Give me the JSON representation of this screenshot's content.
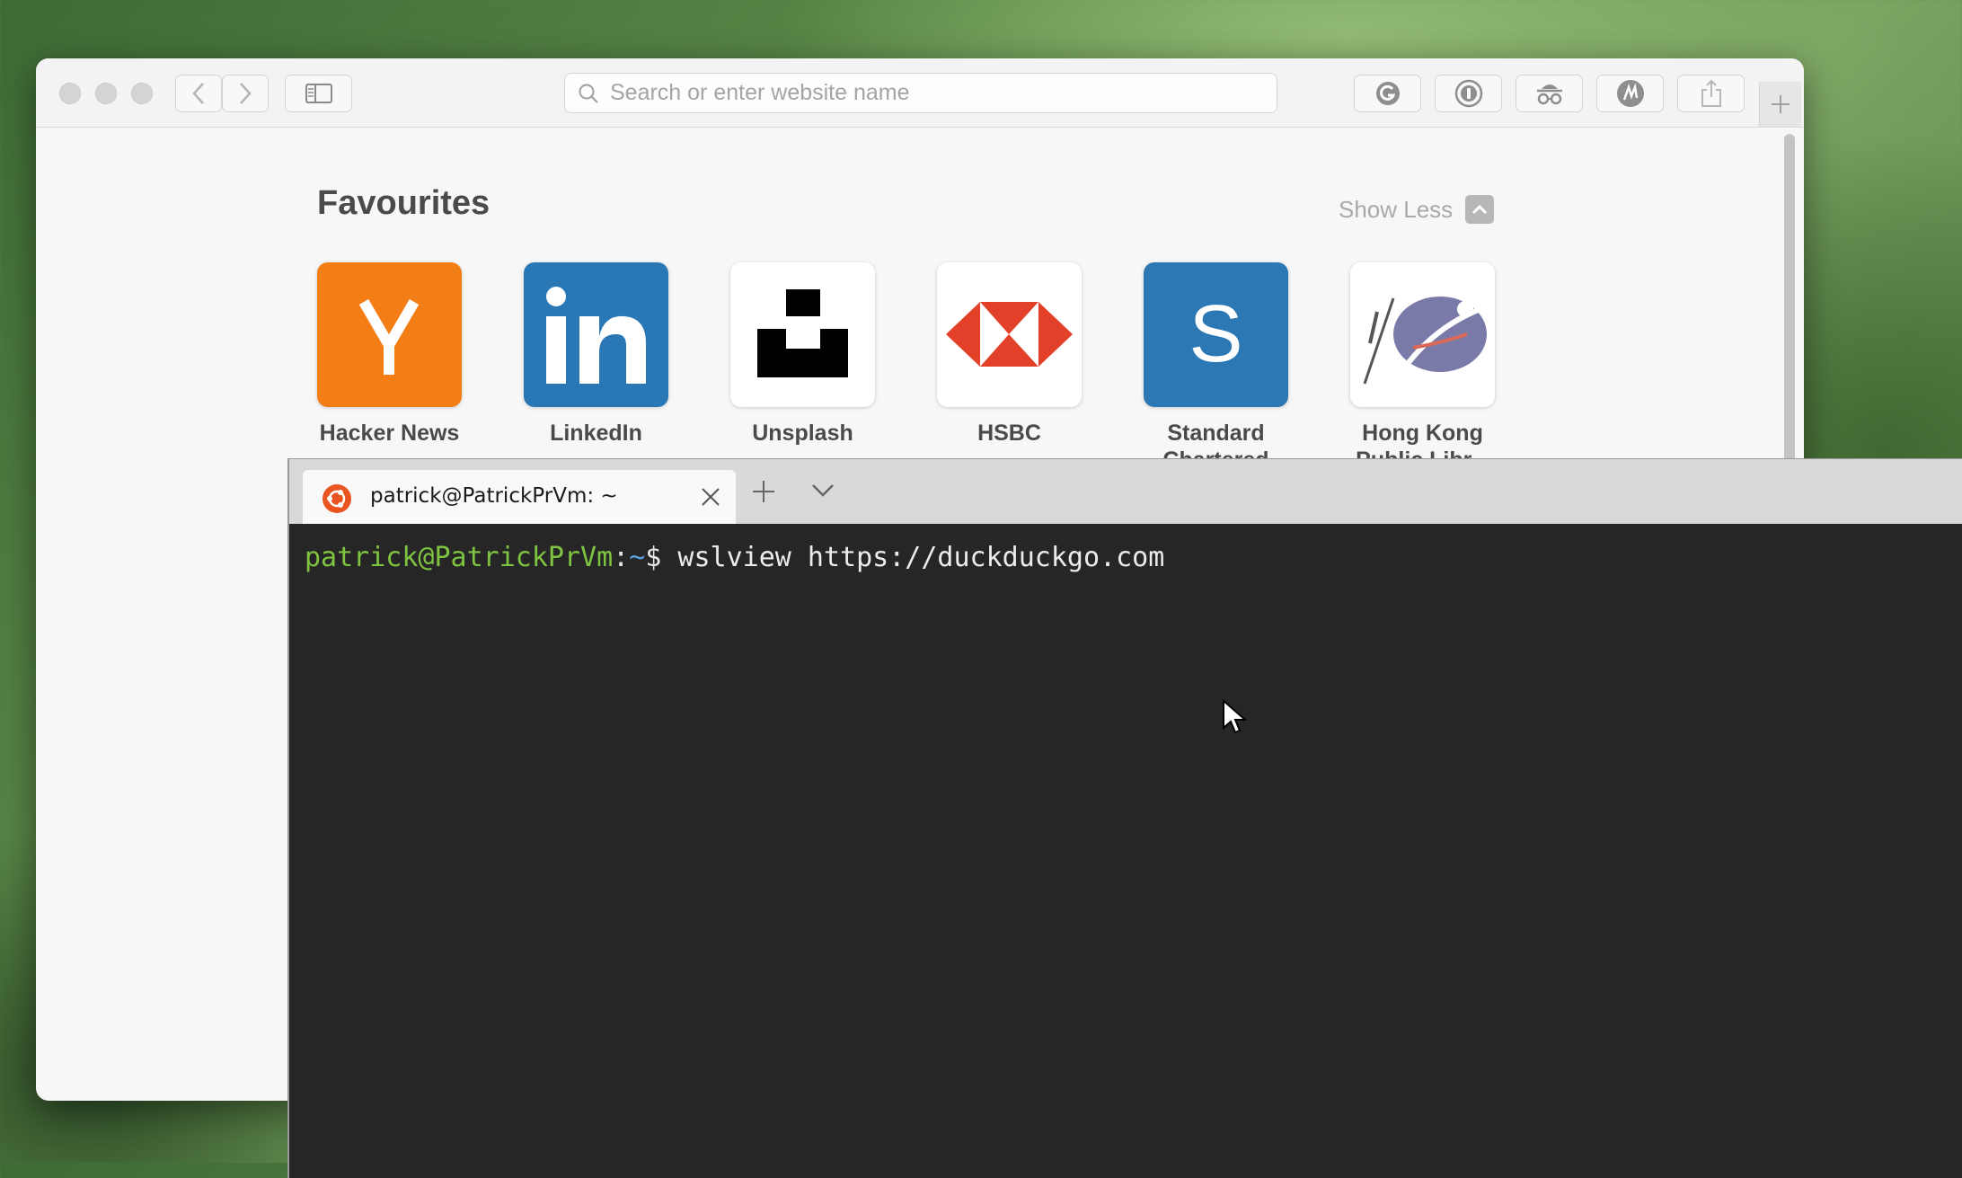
{
  "browser": {
    "search": {
      "placeholder": "Search or enter website name"
    },
    "favourites": {
      "title": "Favourites",
      "toggle_label": "Show Less",
      "items": [
        {
          "label": "Hacker News",
          "icon": "y-combinator-icon",
          "color": "#f47e16"
        },
        {
          "label": "LinkedIn",
          "icon": "linkedin-icon",
          "color": "#2977b5"
        },
        {
          "label": "Unsplash",
          "icon": "unsplash-icon",
          "color": "#000000"
        },
        {
          "label": "HSBC",
          "icon": "hsbc-icon",
          "color": "#db0011"
        },
        {
          "label": "Standard Chartered",
          "icon": "standard-chartered-icon",
          "color": "#2b78b4",
          "glyph": "S"
        },
        {
          "label": "Hong Kong Public Libr...",
          "icon": "hkpl-icon",
          "color": "#6a6a9a"
        }
      ]
    }
  },
  "terminal": {
    "tab_title": "patrick@PatrickPrVm: ~",
    "prompt_user": "patrick@PatrickPrVm",
    "prompt_colon": ":",
    "prompt_path": "~",
    "prompt_symbol": "$ ",
    "command": "wslview https://duckduckgo.com"
  }
}
